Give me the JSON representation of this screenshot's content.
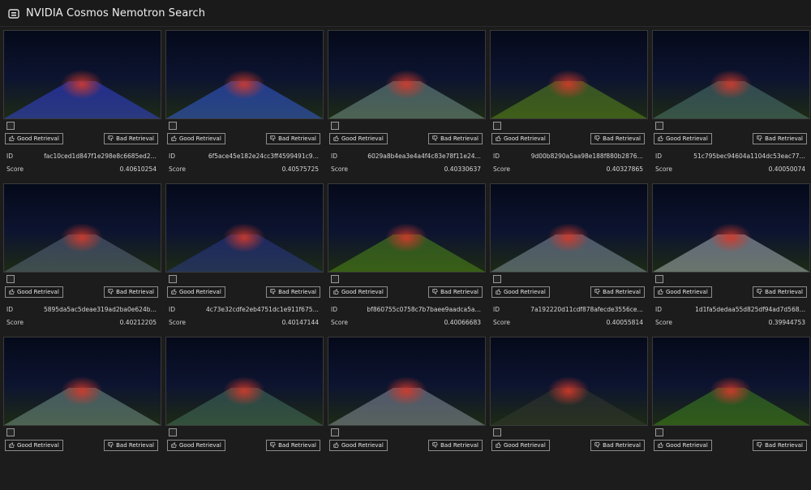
{
  "app": {
    "title": "NVIDIA Cosmos Nemotron Search"
  },
  "labels": {
    "good": "Good Retrieval",
    "bad": "Bad Retrieval",
    "id": "ID",
    "score": "Score"
  },
  "results": [
    {
      "id": "fac10ced1d847f1e298e8c6685ed2…",
      "score": "0.40610254",
      "scene": "night-blue-lights"
    },
    {
      "id": "6f5ace45e182e24cc3ff4599491c9…",
      "score": "0.40575725",
      "scene": "night-blue-lights-wide"
    },
    {
      "id": "6029a8b4ea3e4a4f4c83e78f11e24…",
      "score": "0.40330637",
      "scene": "rain-truck-teal"
    },
    {
      "id": "9d00b8290a5aa98e188f880b2876…",
      "score": "0.40327865",
      "scene": "night-road-yellow"
    },
    {
      "id": "51c795bec94604a1104dc53eac77…",
      "score": "0.40050074",
      "scene": "rain-truck-teal-dark"
    },
    {
      "id": "5895da5ac5deae319ad2ba0e624b…",
      "score": "0.40212205",
      "scene": "rain-dusk-street"
    },
    {
      "id": "4c73e32cdfe2eb4751dc1e911f675…",
      "score": "0.40147144",
      "scene": "night-highway-blue"
    },
    {
      "id": "bf860755c0758c7b7baee9aadca5a…",
      "score": "0.40066683",
      "scene": "night-road-green"
    },
    {
      "id": "7a192220d11cdf878afecde3556ce…",
      "score": "0.40055814",
      "scene": "dusk-firetruck"
    },
    {
      "id": "1d1fa5dedaa55d825df94ad7d568…",
      "score": "0.39944753",
      "scene": "day-firetruck"
    },
    {
      "id": "",
      "score": "",
      "scene": "rain-truck-teal"
    },
    {
      "id": "",
      "score": "",
      "scene": "rain-green-street"
    },
    {
      "id": "",
      "score": "",
      "scene": "dusk-truck-street"
    },
    {
      "id": "",
      "score": "",
      "scene": "night-highway-dark"
    },
    {
      "id": "",
      "score": "",
      "scene": "night-green-road"
    }
  ]
}
